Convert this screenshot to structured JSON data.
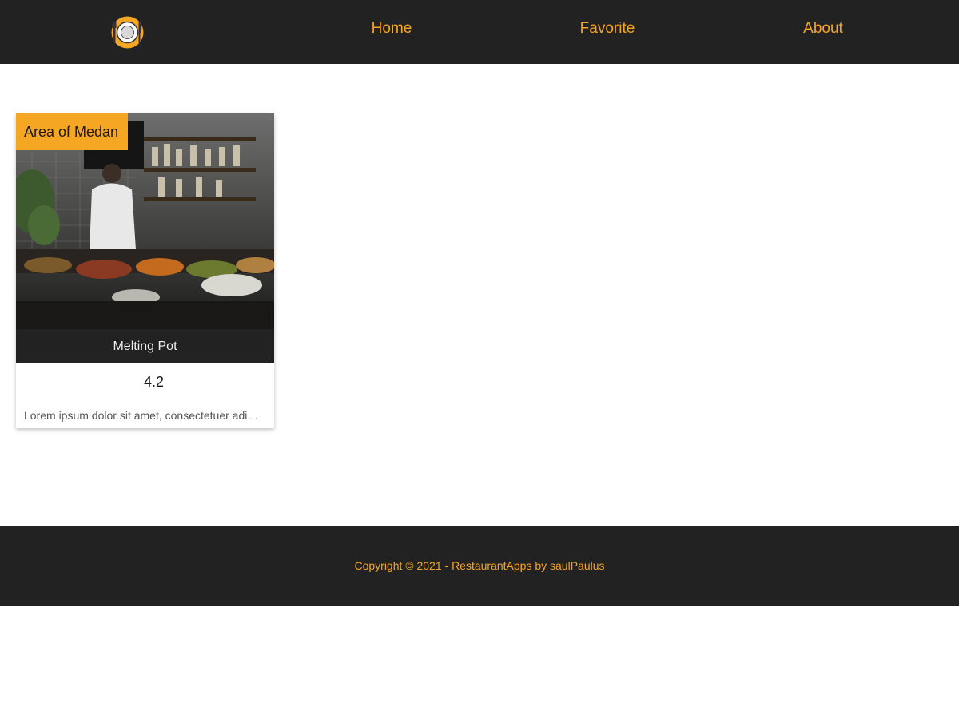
{
  "header": {
    "logo_icon": "plate-fork-knife-icon",
    "nav": [
      {
        "label": "Home"
      },
      {
        "label": "Favorite"
      },
      {
        "label": "About"
      }
    ],
    "colors": {
      "bar": "#222222",
      "accent": "#f5a623"
    }
  },
  "restaurants": [
    {
      "area": "Area of Medan",
      "name": "Melting Pot",
      "rating": "4.2",
      "description": "Lorem ipsum dolor sit amet, consectetuer adipiscing elit. Aenean commodo ligula eget dolor.",
      "image_icon": "restaurant-photo"
    }
  ],
  "footer": {
    "text": "Copyright © 2021 - RestaurantApps by saulPaulus"
  }
}
